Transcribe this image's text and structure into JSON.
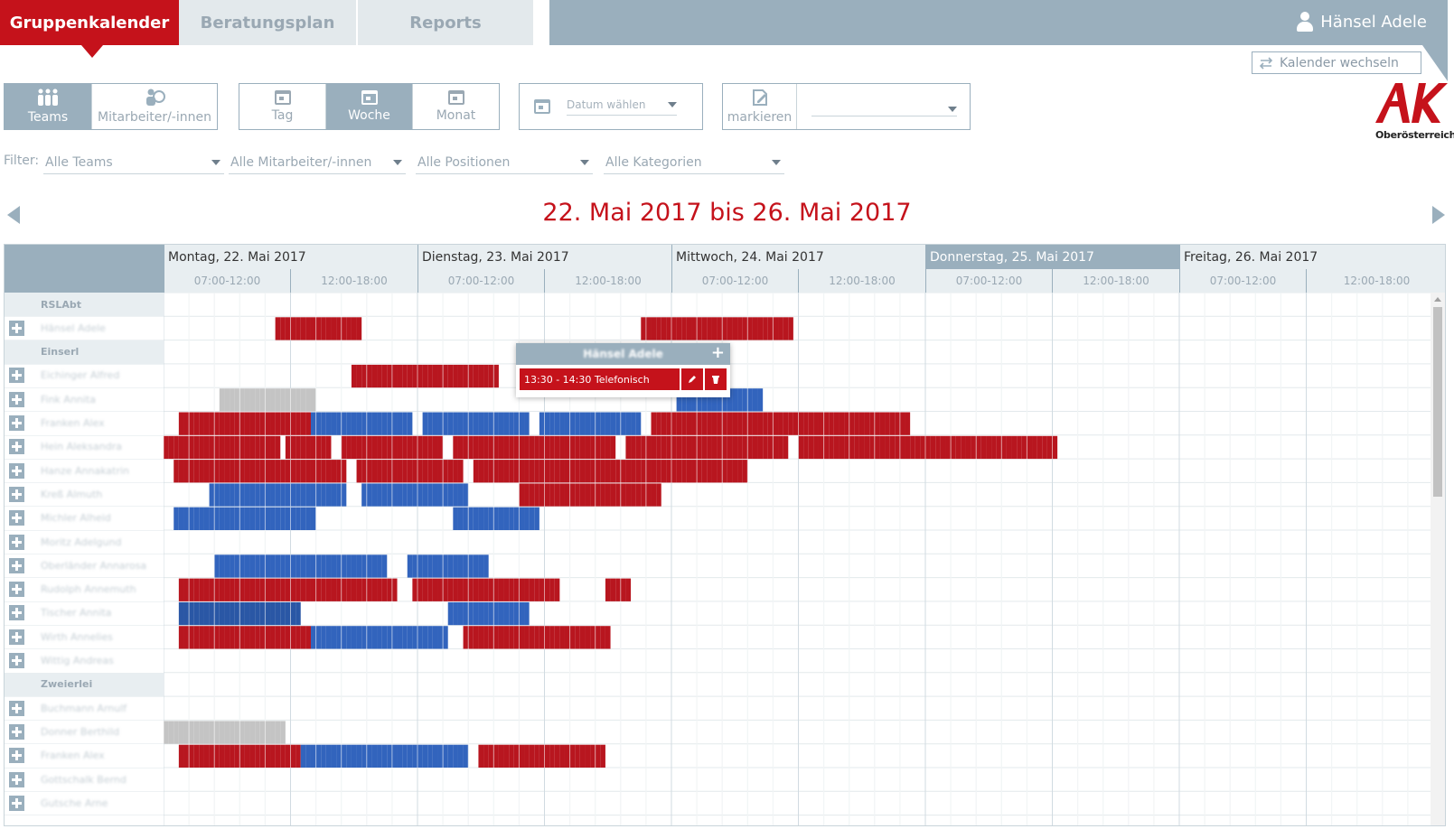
{
  "tabs": [
    {
      "label": "Gruppenkalender",
      "active": true
    },
    {
      "label": "Beratungsplan",
      "active": false
    },
    {
      "label": "Reports",
      "active": false
    }
  ],
  "user": {
    "name": "Hänsel Adele"
  },
  "calendar_switch": {
    "label": "Kalender wechseln"
  },
  "logo": {
    "text": "AK",
    "subtitle": "Oberösterreich"
  },
  "view_mode": {
    "items": [
      {
        "label": "Teams",
        "active": true
      },
      {
        "label": "Mitarbeiter/-innen",
        "active": false
      }
    ]
  },
  "period": {
    "items": [
      {
        "label": "Tag",
        "active": false
      },
      {
        "label": "Woche",
        "active": true
      },
      {
        "label": "Monat",
        "active": false
      }
    ]
  },
  "date_picker": {
    "placeholder": "Datum wählen"
  },
  "mark": {
    "label": "markieren",
    "value": ""
  },
  "filters": {
    "label": "Filter:",
    "teams": "Alle Teams",
    "staff": "Alle Mitarbeiter/-innen",
    "positions": "Alle Positionen",
    "categories": "Alle Kategorien"
  },
  "range_title": "22. Mai 2017 bis 26. Mai 2017",
  "days": [
    {
      "label": "Montag, 22. Mai 2017",
      "highlight": false
    },
    {
      "label": "Dienstag, 23. Mai 2017",
      "highlight": false
    },
    {
      "label": "Mittwoch, 24. Mai 2017",
      "highlight": false
    },
    {
      "label": "Donnerstag, 25. Mai 2017",
      "highlight": true
    },
    {
      "label": "Freitag, 26. Mai 2017",
      "highlight": false
    }
  ],
  "slots": [
    "07:00-12:00",
    "12:00-18:00"
  ],
  "rows": [
    {
      "type": "group",
      "name": "RSLAbt"
    },
    {
      "type": "person",
      "name": "Hänsel Adele"
    },
    {
      "type": "group",
      "name": "Einserl"
    },
    {
      "type": "person",
      "name": "Eichinger Alfred"
    },
    {
      "type": "person",
      "name": "Fink Annita"
    },
    {
      "type": "person",
      "name": "Franken Alex"
    },
    {
      "type": "person",
      "name": "Hein Aleksandra"
    },
    {
      "type": "person",
      "name": "Hanze Annakatrin"
    },
    {
      "type": "person",
      "name": "Kreß Almuth"
    },
    {
      "type": "person",
      "name": "Michler Alheid"
    },
    {
      "type": "person",
      "name": "Moritz Adelgund"
    },
    {
      "type": "person",
      "name": "Oberländer Annarosa"
    },
    {
      "type": "person",
      "name": "Rudolph Annemuth"
    },
    {
      "type": "person",
      "name": "Tischer Annita"
    },
    {
      "type": "person",
      "name": "Wirth Annelies"
    },
    {
      "type": "person",
      "name": "Wittig Andreas"
    },
    {
      "type": "group",
      "name": "Zweierlei"
    },
    {
      "type": "person",
      "name": "Buchmann Arnulf"
    },
    {
      "type": "person",
      "name": "Donner Berthild"
    },
    {
      "type": "person",
      "name": "Franken Alex"
    },
    {
      "type": "person",
      "name": "Gottschalk Bernd"
    },
    {
      "type": "person",
      "name": "Gutsche Arne"
    }
  ],
  "cell_colors": {
    "R": "#b8161f",
    "B": "#3264bd",
    "D": "#2a57a5",
    "G": "#c4c4c4"
  },
  "schedule": [
    "",
    "......................RRRRRRRRRRRRRRRRR.......................................................RRRRRRRRRRRRRRRRRRRRRRRRRRRRRR",
    "",
    ".....................................RRRRRRRRRRRRRRRRRRRRRRRRRRRRR.............................................................................",
    "...........GGGGGGGGGGGGGGGGGGG.......................................................................BBBBBBBBBBBBBBBBB..................................",
    "...RRRRRRRRRRRRRRRRRRRRRRRRRRBBBBBBBBBBBBBBBBBBBB..BBBBBBBBBBBBBBBBBBBBB..BBBBBBBBBBBBBBBBBBBB..RRRRRRRRRRRRRRRRRRRRRRRRRRRRRRRRRRRRRRRRRRRRRRRRRRR",
    "RRRRRRRRRRRRRRRRRRRRRRR.RRRRRRRRR..RRRRRRRRRRRRRRRRRRRR..RRRRRRRRRRRRRRRRRRRRRRRRRRRRRRRR..RRRRRRRRRRRRRRRRRRRRRRRRRRRRRRRR..RRRRRRRRRRRRRRRRRRRRRRRRRRRRRRRRRRRRRRRRRRRRRRRRRRR",
    "..RRRRRRRRRRRRRRRRRRRRRRRRRRRRRRRRRR..RRRRRRRRRRRRRRRRRRRRR..RRRRRRRRRRRRRRRRRRRRRRRRRRRRRRRRRRRRRRRRRRRRRRRRRRRRRR",
    ".........BBBBBBBBBBBBBBBBBBBBBBBBBBB...BBBBBBBBBBBBBBBBBBBBB..........RRRRRRRRRRRRRRRRRRRRRRRRRRRR",
    "..BBBBBBBBBBBBBBBBBBBBBBBBBBBB...........................BBBBBBBBBBBBBBBBB",
    "",
    "..........BBBBBBBBBBBBBBBBBBBBBBBBBBBBBBBBBB....BBBBBBBBBBBBBBBB",
    "...RRRRRRRRRRRRRRRRRRRRRRRRRRRRRRRRRRRRRRRRRRR...RRRRRRRRRRRRRRRRRRRRRRRRRRRRR.........RRRRR",
    "...DDDDDDDDDDDDDDDDDDDDDDDD.............................BBBBBBBBBBBBBBBB",
    "...RRRRRRRRRRRRRRRRRRRRRRRRRRBBBBBBBBBBBBBBBBBBBBBBBBBBB...RRRRRRRRRRRRRRRRRRRRRRRRRRRRR",
    "",
    "",
    "",
    "GGGGGGGGGGGGGGGGGGGGGGGG",
    "...RRRRRRRRRRRRRRRRRRRRRRRRBBBBBBBBBBBBBBBBBBBBBBBBBBBBBBBBB..RRRRRRRRRRRRRRRRRRRRRRRRR",
    "",
    ""
  ],
  "popup": {
    "title": "Hänsel Adele",
    "event": "13:30 - 14:30 Telefonisch"
  }
}
